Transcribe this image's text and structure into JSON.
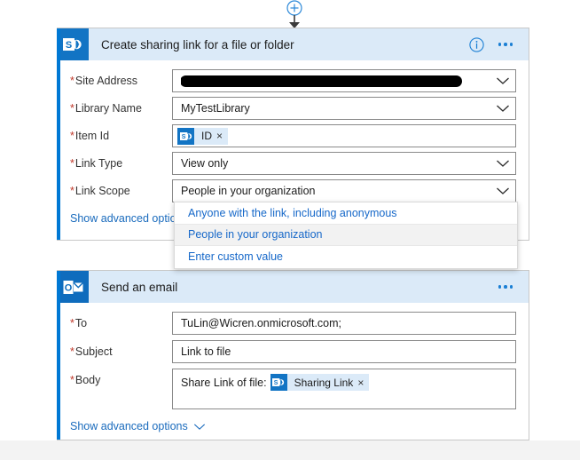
{
  "connector": {
    "add_button": "add-step-plus",
    "arrow": "flow-down-arrow"
  },
  "cards": [
    {
      "id": "sharepoint-create-sharing-link",
      "app": "SharePoint",
      "icon": "sharepoint-icon",
      "title": "Create sharing link for a file or folder",
      "info_icon": "info-icon",
      "menu_icon": "ellipsis-icon",
      "fields": [
        {
          "name": "site-address",
          "label": "Site Address",
          "required": true,
          "type": "dropdown",
          "value": "",
          "redacted": true
        },
        {
          "name": "library-name",
          "label": "Library Name",
          "required": true,
          "type": "dropdown",
          "value": "MyTestLibrary"
        },
        {
          "name": "item-id",
          "label": "Item Id",
          "required": true,
          "type": "token",
          "token": {
            "icon": "sharepoint-icon",
            "text": "ID",
            "remove": "×"
          }
        },
        {
          "name": "link-type",
          "label": "Link Type",
          "required": true,
          "type": "dropdown",
          "value": "View only"
        },
        {
          "name": "link-scope",
          "label": "Link Scope",
          "required": true,
          "type": "dropdown",
          "value": "People in your organization"
        }
      ],
      "advanced_label": "Show advanced options"
    },
    {
      "id": "outlook-send-an-email",
      "app": "Outlook",
      "icon": "outlook-icon",
      "title": "Send an email",
      "menu_icon": "ellipsis-icon",
      "fields": [
        {
          "name": "email-to",
          "label": "To",
          "required": true,
          "type": "text",
          "value": "TuLin@Wicren.onmicrosoft.com;"
        },
        {
          "name": "email-subject",
          "label": "Subject",
          "required": true,
          "type": "text",
          "value": "Link to file"
        },
        {
          "name": "email-body",
          "label": "Body",
          "required": true,
          "type": "rich",
          "prefix": "Share Link of file:",
          "token": {
            "icon": "sharepoint-icon",
            "text": "Sharing Link",
            "remove": "×"
          }
        }
      ],
      "advanced_label": "Show advanced options"
    }
  ],
  "dropdown": {
    "name": "link-scope-dropdown",
    "options": [
      {
        "label": "Anyone with the link, including anonymous",
        "selected": false
      },
      {
        "label": "People in your organization",
        "selected": true
      },
      {
        "label": "Enter custom value",
        "selected": false
      }
    ]
  },
  "colors": {
    "accent": "#0078d4",
    "header_bg": "#dbeaf8",
    "link": "#1668c9",
    "required": "#c0392b",
    "app_tile": "#1274c4"
  }
}
